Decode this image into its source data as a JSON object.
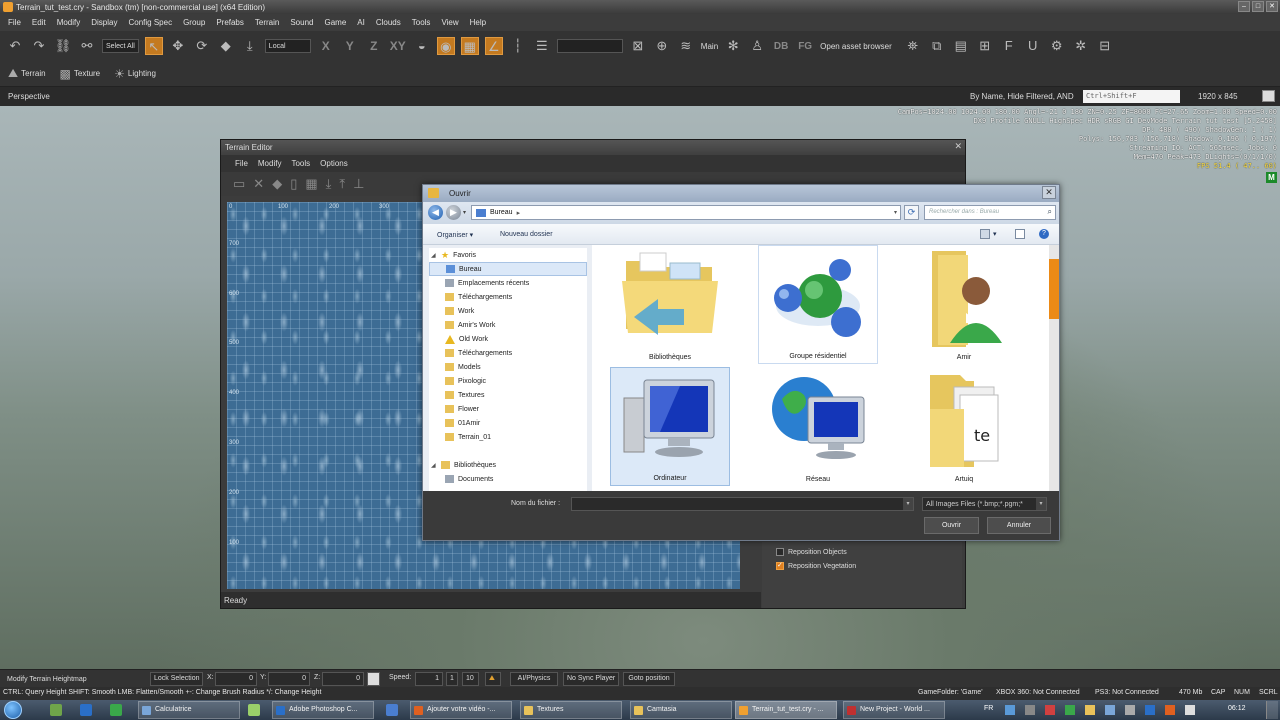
{
  "window": {
    "title": "Terrain_tut_test.cry - Sandbox (tm) [non-commercial use] (x64 Edition)"
  },
  "menu": [
    "File",
    "Edit",
    "Modify",
    "Display",
    "Config Spec",
    "Group",
    "Prefabs",
    "Terrain",
    "Sound",
    "Game",
    "AI",
    "Clouds",
    "Tools",
    "View",
    "Help"
  ],
  "toolbar": {
    "select_all": "Select All",
    "coord_space": "Local",
    "axes": [
      "X",
      "Y",
      "Z",
      "XY"
    ],
    "layer": "Main",
    "asset_browser": "Open asset browser",
    "db": "DB",
    "fg": "FG"
  },
  "toolbar2": {
    "terrain": "Terrain",
    "texture": "Texture",
    "lighting": "Lighting"
  },
  "viewport": {
    "title": "Perspective",
    "filter": "By Name, Hide Filtered, AND",
    "search": "Ctrl+Shift+F",
    "resolution": "1920 x 845",
    "stats": [
      "CamPos=1024.00 1024.00 180.00 Angl=-21  0 180 ZN=0.25 ZF=8000 FC=27.65 Zoom=1.00 Speed=0.00",
      "DX9 Profile GNULL HighSpec HDR sRGB GI DevMode Terrain tut test [5.2458]",
      "DP: 488 ( 490) ShadowGen: 1 (  1)",
      "Polys: 156,783 (156,718) Shadow: 0,196 ( 0,197)",
      "Streaming IO: ACT: 565msec, Jobs: 0",
      "Mem=470 Peak=473 DLights=(0/1/1/0)"
    ],
    "fps": "FPS  51.4 ( 47.. 60)",
    "badge": "M"
  },
  "terrain_editor": {
    "title": "Terrain Editor",
    "menu": [
      "File",
      "Modify",
      "Tools",
      "Options"
    ],
    "ticks_x": [
      "0",
      "100",
      "200",
      "300"
    ],
    "ticks_y": [
      "700",
      "600",
      "500",
      "400",
      "300",
      "200",
      "100"
    ],
    "status": "Ready",
    "options": [
      {
        "label": "Reposition Objects",
        "checked": false
      },
      {
        "label": "Reposition Vegetation",
        "checked": true
      }
    ]
  },
  "dialog": {
    "title": "Ouvrir",
    "address": "Bureau",
    "search_placeholder": "Rechercher dans : Bureau",
    "organize": "Organiser",
    "new_folder": "Nouveau dossier",
    "tree": [
      {
        "label": "Favoris",
        "level": 0,
        "icon": "star",
        "expanded": true
      },
      {
        "label": "Bureau",
        "level": 1,
        "icon": "blue",
        "selected": true
      },
      {
        "label": "Emplacements récents",
        "level": 1,
        "icon": "gray"
      },
      {
        "label": "Téléchargements",
        "level": 1,
        "icon": "yellow"
      },
      {
        "label": "Work",
        "level": 1,
        "icon": "yellow"
      },
      {
        "label": "Amir's Work",
        "level": 1,
        "icon": "yellow"
      },
      {
        "label": "Old Work",
        "level": 1,
        "icon": "warn"
      },
      {
        "label": "Téléchargements",
        "level": 1,
        "icon": "yellow"
      },
      {
        "label": "Models",
        "level": 1,
        "icon": "yellow"
      },
      {
        "label": "Pixologic",
        "level": 1,
        "icon": "yellow"
      },
      {
        "label": "Textures",
        "level": 1,
        "icon": "yellow"
      },
      {
        "label": "Flower",
        "level": 1,
        "icon": "yellow"
      },
      {
        "label": "01Amir",
        "level": 1,
        "icon": "yellow"
      },
      {
        "label": "Terrain_01",
        "level": 1,
        "icon": "yellow"
      },
      {
        "label": "",
        "level": 1,
        "icon": "none"
      },
      {
        "label": "Bibliothèques",
        "level": 0,
        "icon": "yellow",
        "expanded": true
      },
      {
        "label": "Documents",
        "level": 1,
        "icon": "gray"
      }
    ],
    "items": [
      {
        "label": "Bibliothèques",
        "kind": "library"
      },
      {
        "label": "Groupe résidentiel",
        "kind": "homegroup",
        "hover": true
      },
      {
        "label": "Amir",
        "kind": "user"
      },
      {
        "label": "Ordinateur",
        "kind": "computer",
        "selected": true
      },
      {
        "label": "Réseau",
        "kind": "network"
      },
      {
        "label": "Artuiq",
        "kind": "folder"
      }
    ],
    "filename_label": "Nom du fichier :",
    "filename_value": "",
    "filetype": "All Images Files (*.bmp;*.pgm;*",
    "open": "Ouvrir",
    "cancel": "Annuler"
  },
  "statusbar": {
    "mode": "Modify Terrain Heightmap",
    "lock": "Lock Selection",
    "x_label": "X:",
    "x_value": "0",
    "y_label": "Y:",
    "y_value": "0",
    "z_label": "Z:",
    "z_value": "0",
    "speed_label": "Speed:",
    "speed_value": "1",
    "speed_presets": [
      "1",
      "10"
    ],
    "ai_physics": "AI/Physics",
    "no_sync": "No Sync Player",
    "goto": "Goto position",
    "hint": "CTRL: Query Height  SHIFT: Smooth  LMB: Flatten/Smooth  +-: Change Brush Radius  */: Change Height",
    "game_folder": "GameFolder: 'Game'",
    "xbox": "XBOX 360: Not Connected",
    "ps3": "PS3: Not Connected",
    "mem": "470 Mb",
    "cap": "CAP",
    "num": "NUM",
    "scrl": "SCRL"
  },
  "taskbar": {
    "tasks": [
      {
        "label": "Calculatrice",
        "color": "#7aa6d8"
      },
      {
        "label": "Adobe Photoshop C...",
        "color": "#2a6fc8"
      },
      {
        "label": "Ajouter votre vidéo -...",
        "color": "#e06020"
      },
      {
        "label": "Textures",
        "color": "#e8c25a"
      },
      {
        "label": "Camtasia",
        "color": "#e8c25a"
      },
      {
        "label": "Terrain_tut_test.cry - ...",
        "color": "#f0a030",
        "active": true
      },
      {
        "label": "New Project - World ...",
        "color": "#c03030"
      }
    ],
    "lang": "FR",
    "time": "06:12"
  }
}
